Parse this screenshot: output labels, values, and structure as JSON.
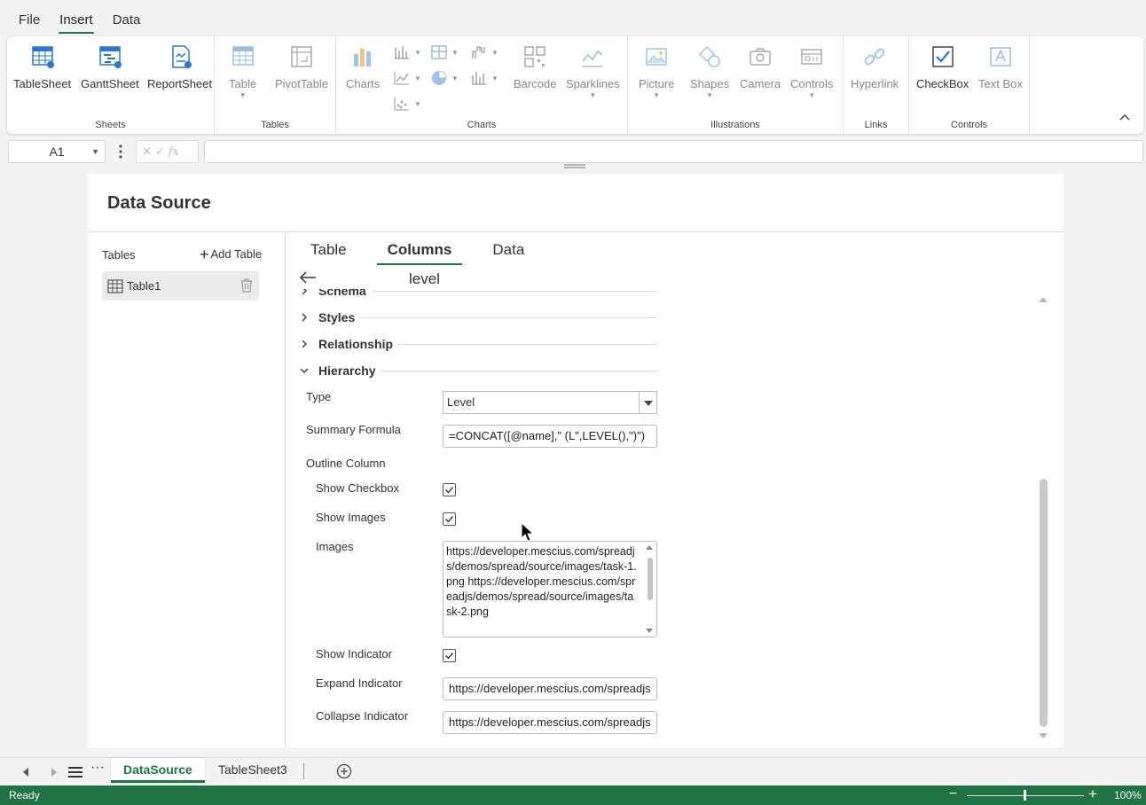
{
  "menu": {
    "tabs": [
      "File",
      "Insert",
      "Data"
    ],
    "active": "Insert"
  },
  "ribbon": {
    "groups": {
      "sheets": "Sheets",
      "tables": "Tables",
      "charts": "Charts",
      "illustrations": "Illustrations",
      "links": "Links",
      "controls": "Controls"
    },
    "buttons": {
      "tablesheet": "TableSheet",
      "ganttsheet": "GanttSheet",
      "reportsheet": "ReportSheet",
      "table": "Table",
      "pivottable": "PivotTable",
      "charts": "Charts",
      "barcode": "Barcode",
      "sparklines": "Sparklines",
      "picture": "Picture",
      "shapes": "Shapes",
      "camera": "Camera",
      "controls": "Controls",
      "hyperlink": "Hyperlink",
      "checkbox": "CheckBox",
      "textbox": "Text Box"
    }
  },
  "formula_bar": {
    "cell_ref": "A1",
    "formula": ""
  },
  "panel": {
    "title": "Data Source",
    "tables_label": "Tables",
    "add_table": "Add Table",
    "table_items": [
      "Table1"
    ],
    "tabs": [
      "Table",
      "Columns",
      "Data"
    ],
    "active_tab": "Columns",
    "column_name": "level",
    "sections": {
      "schema": "Schema",
      "styles": "Styles",
      "relationship": "Relationship",
      "hierarchy": "Hierarchy"
    },
    "fields": {
      "type_label": "Type",
      "type_value": "Level",
      "summary_label": "Summary Formula",
      "summary_value": "=CONCAT([@name],\" (L\",LEVEL(),\")\")",
      "outline_label": "Outline Column",
      "show_checkbox_label": "Show Checkbox",
      "show_images_label": "Show Images",
      "images_label": "Images",
      "images_value": "https://developer.mescius.com/spreadjs/demos/spread/source/images/task-1.png\nhttps://developer.mescius.com/spreadjs/demos/spread/source/images/task-2.png",
      "show_indicator_label": "Show Indicator",
      "expand_label": "Expand Indicator",
      "expand_value": "https://developer.mescius.com/spreadjs",
      "collapse_label": "Collapse Indicator",
      "collapse_value": "https://developer.mescius.com/spreadjs"
    }
  },
  "sheets": {
    "tabs": [
      "DataSource",
      "TableSheet3"
    ],
    "active": "DataSource"
  },
  "status": {
    "text": "Ready",
    "zoom": "100%"
  },
  "colors": {
    "accent": "#217346"
  }
}
